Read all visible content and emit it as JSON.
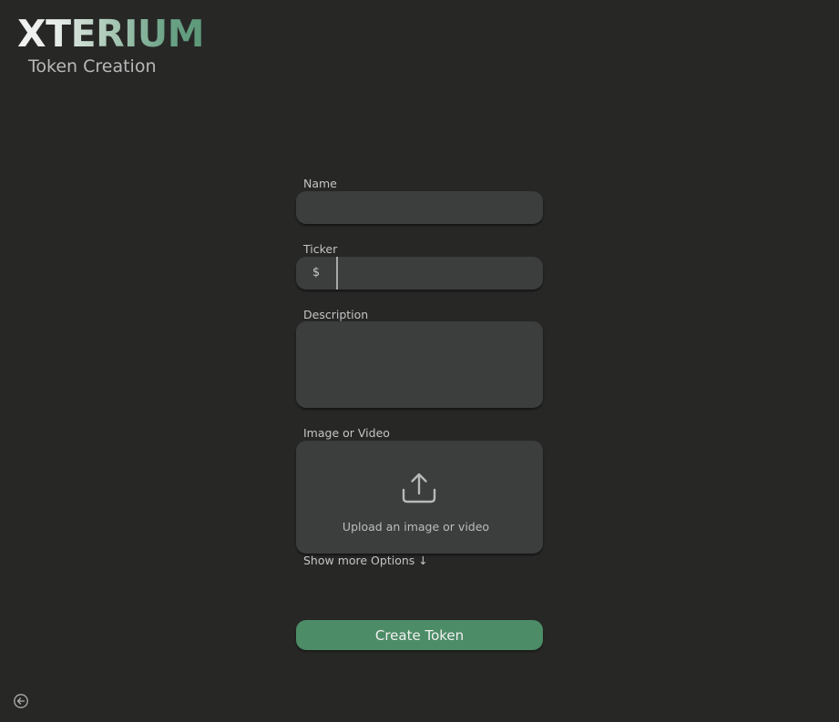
{
  "header": {
    "logo_text": "XTERIUM",
    "subtitle": "Token Creation"
  },
  "form": {
    "name": {
      "label": "Name",
      "value": ""
    },
    "ticker": {
      "label": "Ticker",
      "prefix": "$",
      "value": ""
    },
    "description": {
      "label": "Description",
      "value": ""
    },
    "media": {
      "label": "Image or Video",
      "upload_text": "Upload an image or video",
      "icon": "upload-icon"
    },
    "more_options_label": "Show more Options ↓",
    "submit_label": "Create Token"
  },
  "footer": {
    "back_icon": "back-arrow-icon"
  },
  "colors": {
    "background": "#272726",
    "field": "#3c3d3d",
    "accent": "#4c8c66",
    "logo_gradient_end": "#5b9777"
  }
}
